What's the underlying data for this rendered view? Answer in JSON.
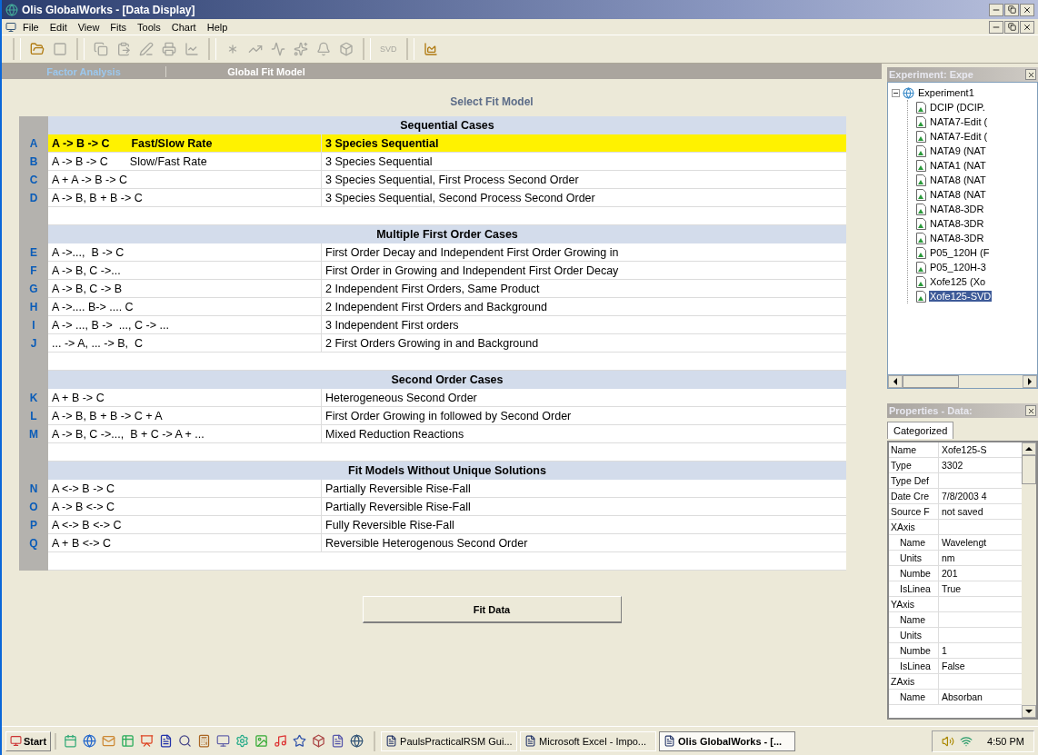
{
  "window": {
    "title": "Olis GlobalWorks - [Data Display]"
  },
  "menu": [
    "File",
    "Edit",
    "View",
    "Fits",
    "Tools",
    "Chart",
    "Help"
  ],
  "toolbar": [
    {
      "kind": "open",
      "disabled": false
    },
    {
      "kind": "save",
      "disabled": true
    },
    {
      "kind": "sep"
    },
    {
      "kind": "copy",
      "disabled": true
    },
    {
      "kind": "paste",
      "disabled": true
    },
    {
      "kind": "edit",
      "disabled": true
    },
    {
      "kind": "print",
      "disabled": true
    },
    {
      "kind": "plot",
      "disabled": true
    },
    {
      "kind": "sep"
    },
    {
      "kind": "star",
      "disabled": true
    },
    {
      "kind": "peak",
      "disabled": true
    },
    {
      "kind": "spike",
      "disabled": true
    },
    {
      "kind": "burst",
      "disabled": true
    },
    {
      "kind": "bell",
      "disabled": true
    },
    {
      "kind": "cube",
      "disabled": true
    },
    {
      "kind": "sep"
    },
    {
      "kind": "svd",
      "label": "SVD",
      "disabled": true
    },
    {
      "kind": "sep"
    },
    {
      "kind": "chart",
      "disabled": false
    }
  ],
  "tabs": [
    {
      "label": "Factor Analysis",
      "selected": false
    },
    {
      "label": "Global Fit Model",
      "selected": true
    }
  ],
  "fit_model": {
    "title": "Select Fit Model",
    "sections": [
      {
        "heading": "Sequential Cases",
        "rows": [
          {
            "letter": "A",
            "reaction": "A -> B -> C",
            "note": "Fast/Slow Rate",
            "description": "3 Species Sequential",
            "selected": true
          },
          {
            "letter": "B",
            "reaction": "A -> B -> C",
            "note": "Slow/Fast Rate",
            "description": "3 Species Sequential",
            "selected": false
          },
          {
            "letter": "C",
            "reaction": "A + A -> B -> C",
            "description": "3 Species Sequential, First Process Second Order",
            "selected": false
          },
          {
            "letter": "D",
            "reaction": "A -> B, B + B -> C",
            "description": "3 Species Sequential, Second Process Second Order",
            "selected": false
          }
        ]
      },
      {
        "heading": "Multiple First Order Cases",
        "rows": [
          {
            "letter": "E",
            "reaction": "A ->...,  B -> C",
            "description": "First Order Decay and Independent First Order Growing in",
            "selected": false
          },
          {
            "letter": "F",
            "reaction": "A -> B, C ->...",
            "description": "First Order in Growing and Independent First Order Decay",
            "selected": false
          },
          {
            "letter": "G",
            "reaction": "A -> B, C -> B",
            "description": "2 Independent First Orders, Same Product",
            "selected": false
          },
          {
            "letter": "H",
            "reaction": "A ->.... B-> .... C",
            "description": "2 Independent First Orders and Background",
            "selected": false
          },
          {
            "letter": "I",
            "reaction": "A -> ..., B ->  ..., C -> ...",
            "description": "3 Independent First orders",
            "selected": false
          },
          {
            "letter": "J",
            "reaction": "... -> A, ... -> B,  C",
            "description": "2 First Orders Growing in and Background",
            "selected": false
          }
        ]
      },
      {
        "heading": "Second Order Cases",
        "rows": [
          {
            "letter": "K",
            "reaction": "A + B -> C",
            "description": "Heterogeneous Second Order",
            "selected": false
          },
          {
            "letter": "L",
            "reaction": "A -> B, B + B -> C + A",
            "description": "First Order Growing in followed by Second Order",
            "selected": false
          },
          {
            "letter": "M",
            "reaction": "A -> B, C ->...,  B + C -> A + ...",
            "description": "Mixed Reduction Reactions",
            "selected": false
          }
        ]
      },
      {
        "heading": "Fit Models Without Unique Solutions",
        "rows": [
          {
            "letter": "N",
            "reaction": "A <-> B -> C",
            "description": "Partially Reversible Rise-Fall",
            "selected": false
          },
          {
            "letter": "O",
            "reaction": "A -> B <-> C",
            "description": "Partially Reversible Rise-Fall",
            "selected": false
          },
          {
            "letter": "P",
            "reaction": "A <-> B <-> C",
            "description": "Fully Reversible Rise-Fall",
            "selected": false
          },
          {
            "letter": "Q",
            "reaction": "A + B <-> C",
            "description": "Reversible Heterogenous Second Order",
            "selected": false
          }
        ]
      }
    ],
    "button": "Fit Data"
  },
  "experiment_panel": {
    "title": "Experiment: Expe",
    "tree": [
      {
        "label": "Experiment1",
        "expanded": true,
        "selected": false,
        "children": [
          {
            "label": "DCIP (DCIP.",
            "selected": false
          },
          {
            "label": "NATA7-Edit (",
            "selected": false
          },
          {
            "label": "NATA7-Edit (",
            "selected": false
          },
          {
            "label": "NATA9 (NAT",
            "selected": false
          },
          {
            "label": "NATA1 (NAT",
            "selected": false
          },
          {
            "label": "NATA8 (NAT",
            "selected": false
          },
          {
            "label": "NATA8 (NAT",
            "selected": false
          },
          {
            "label": "NATA8-3DR",
            "selected": false
          },
          {
            "label": "NATA8-3DR",
            "selected": false
          },
          {
            "label": "NATA8-3DR",
            "selected": false
          },
          {
            "label": "P05_120H (F",
            "selected": false
          },
          {
            "label": "P05_120H-3",
            "selected": false
          },
          {
            "label": "Xofe125 (Xo",
            "selected": false
          },
          {
            "label": "Xofe125-SVD",
            "selected": true
          }
        ]
      }
    ]
  },
  "properties_panel": {
    "title": "Properties - Data:",
    "tab": "Categorized",
    "rows": [
      {
        "name": "Name",
        "value": "Xofe125-S"
      },
      {
        "name": "Type",
        "value": "3302"
      },
      {
        "name": "Type Def"
      },
      {
        "name": "Date Cre",
        "value": "7/8/2003 4"
      },
      {
        "name": "Source F",
        "value": "not saved"
      },
      {
        "name": "XAxis",
        "children": [
          {
            "name": "Name",
            "value": "Wavelengt"
          },
          {
            "name": "Units",
            "value": "nm"
          },
          {
            "name": "Numbe",
            "value": "201"
          },
          {
            "name": "IsLinea",
            "value": "True"
          }
        ]
      },
      {
        "name": "YAxis",
        "children": [
          {
            "name": "Name"
          },
          {
            "name": "Units"
          },
          {
            "name": "Numbe",
            "value": "1"
          },
          {
            "name": "IsLinea",
            "value": "False"
          }
        ]
      },
      {
        "name": "ZAxis",
        "children": [
          {
            "name": "Name",
            "value": "Absorban"
          }
        ]
      }
    ]
  },
  "taskbar": {
    "start": "Start",
    "tasks": [
      {
        "label": "PaulsPracticalRSM Gui...",
        "selected": false
      },
      {
        "label": "Microsoft Excel - Impo...",
        "selected": false
      },
      {
        "label": "Olis GlobalWorks - [...",
        "selected": true
      }
    ],
    "clock": "4:50 PM"
  }
}
